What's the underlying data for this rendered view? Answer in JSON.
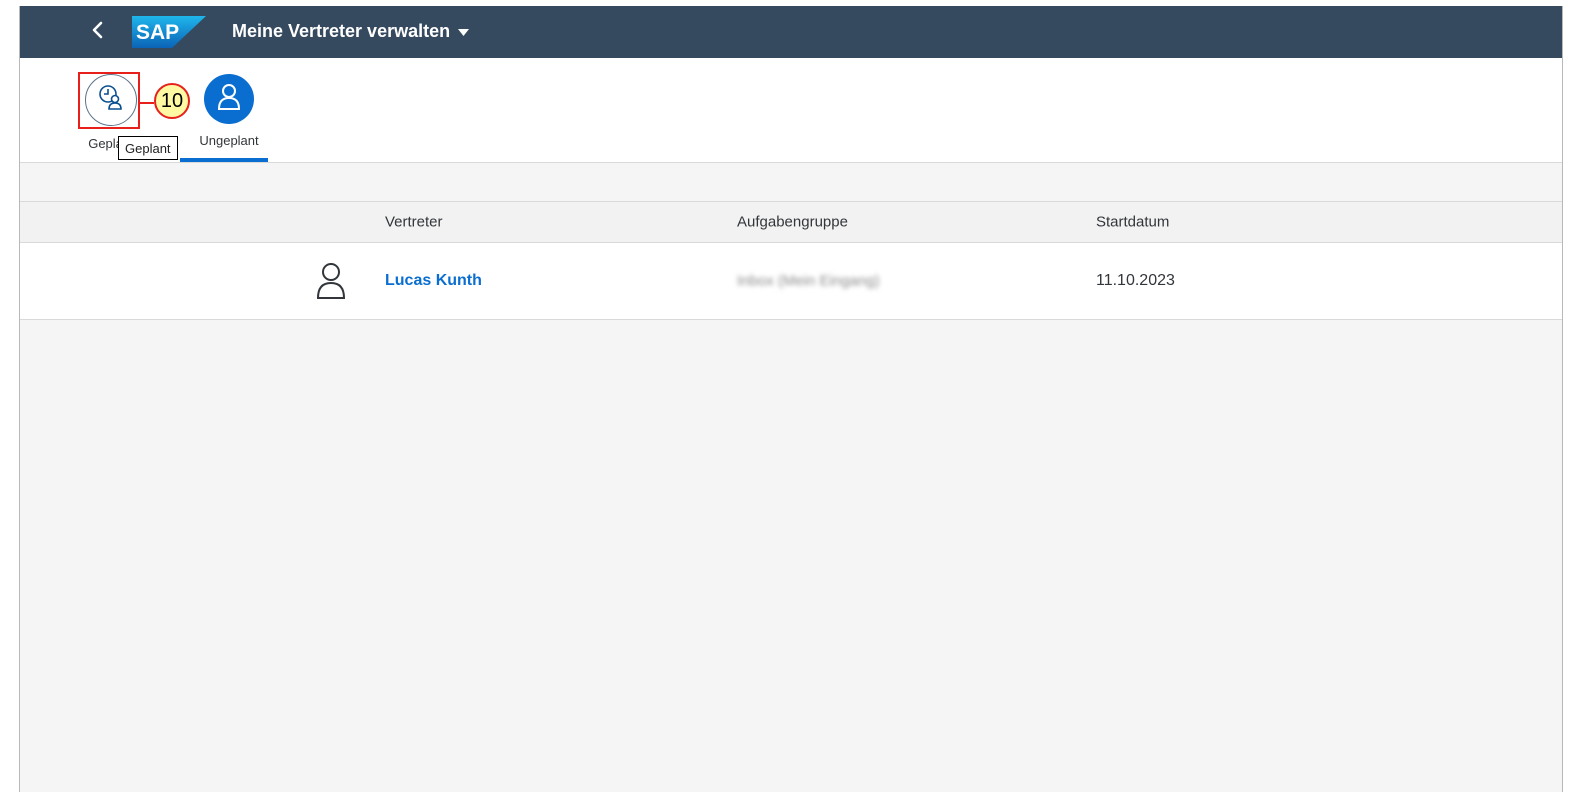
{
  "shell": {
    "app_title": "Meine Vertreter verwalten",
    "logo_text": "SAP",
    "colors": {
      "shell": "#354a5f",
      "accent": "#0a6ed1"
    }
  },
  "tabs": [
    {
      "label": "Geplant",
      "icon": "clock-person-icon",
      "selected": false
    },
    {
      "label": "Ungeplant",
      "icon": "person-icon",
      "selected": true
    }
  ],
  "annotation": {
    "step_number": "10",
    "tooltip": "Geplant"
  },
  "table": {
    "columns": [
      "Vertreter",
      "Aufgabengruppe",
      "Startdatum"
    ],
    "rows": [
      {
        "vertreter": "Lucas Kunth",
        "aufgabengruppe": "Inbox (Mein Eingang)",
        "startdatum": "11.10.2023"
      }
    ]
  }
}
